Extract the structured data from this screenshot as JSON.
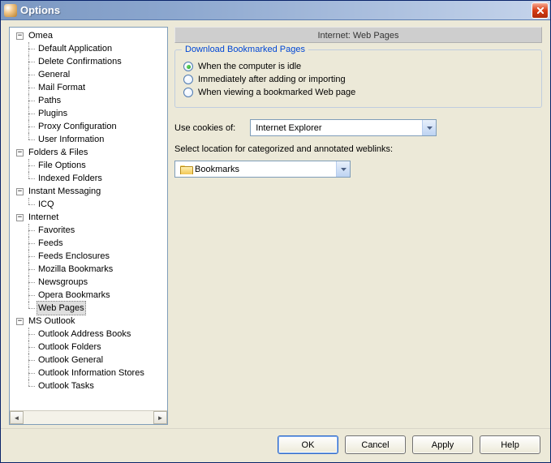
{
  "window": {
    "title": "Options"
  },
  "tree": {
    "omea": "Omea",
    "omea_children": [
      "Default Application",
      "Delete Confirmations",
      "General",
      "Mail Format",
      "Paths",
      "Plugins",
      "Proxy Configuration",
      "User Information"
    ],
    "folders_files": "Folders & Files",
    "folders_files_children": [
      "File Options",
      "Indexed Folders"
    ],
    "instant_messaging": "Instant Messaging",
    "im_children": [
      "ICQ"
    ],
    "internet": "Internet",
    "internet_children": [
      "Favorites",
      "Feeds",
      "Feeds Enclosures",
      "Mozilla Bookmarks",
      "Newsgroups",
      "Opera Bookmarks",
      "Web Pages"
    ],
    "outlook": "MS Outlook",
    "outlook_children": [
      "Outlook Address Books",
      "Outlook Folders",
      "Outlook General",
      "Outlook Information Stores",
      "Outlook Tasks"
    ]
  },
  "panel": {
    "heading": "Internet: Web Pages",
    "group_title": "Download Bookmarked Pages",
    "radio1": "When the computer is idle",
    "radio2": "Immediately after adding or importing",
    "radio3": "When viewing a bookmarked Web page",
    "selected_radio": 0,
    "cookies_label": "Use cookies of:",
    "cookies_value": "Internet Explorer",
    "location_label": "Select location for categorized and annotated weblinks:",
    "location_value": "Bookmarks"
  },
  "buttons": {
    "ok": "OK",
    "cancel": "Cancel",
    "apply": "Apply",
    "help": "Help"
  }
}
